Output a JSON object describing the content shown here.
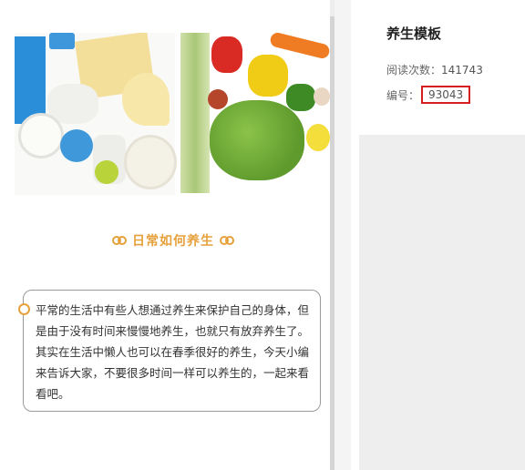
{
  "preview": {
    "hero_image": "vegetables-and-dairy-image",
    "section_title": "日常如何养生",
    "section_icon": "link-icon",
    "accent_color": "#e6a13c",
    "quote_text": "平常的生活中有些人想通过养生来保护自己的身体，但是由于没有时间来慢慢地养生，也就只有放弃养生了。其实在生活中懒人也可以在春季很好的养生，今天小编来告诉大家，不要很多时间一样可以养生的，一起来看看吧。"
  },
  "info": {
    "title": "养生模板",
    "views_label": "阅读次数：",
    "views_value": "141743",
    "code_label": "编号：",
    "code_value": "93043",
    "highlight_color": "#d61f1f"
  }
}
